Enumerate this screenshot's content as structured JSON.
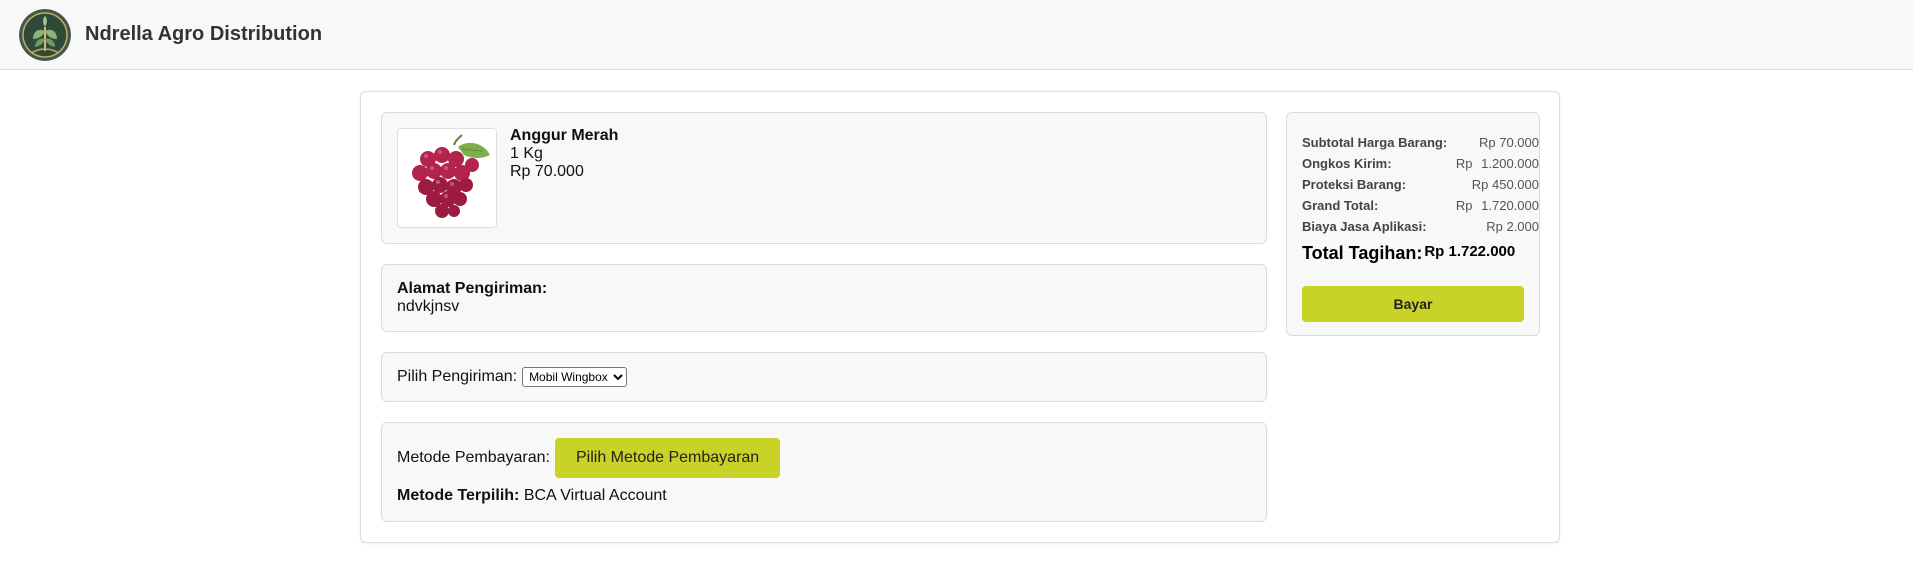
{
  "header": {
    "title": "Ndrella Agro Distribution",
    "logo_icon": "leaf-plant-logo-icon"
  },
  "product": {
    "image_icon": "red-grapes-image",
    "name": "Anggur Merah",
    "quantity": "1 Kg",
    "price": "Rp 70.000"
  },
  "address": {
    "label": "Alamat Pengiriman:",
    "value": "ndvkjnsv"
  },
  "shipping": {
    "label": "Pilih Pengiriman:",
    "selected": "Mobil Wingbox"
  },
  "payment": {
    "label": "Metode Pembayaran:",
    "button_label": "Pilih Metode Pembayaran",
    "selected_label": "Metode Terpilih:",
    "selected_value": "BCA Virtual Account"
  },
  "summary": {
    "rows": [
      {
        "label": "Subtotal Harga Barang:",
        "currency": "",
        "value": "Rp 70.000"
      },
      {
        "label": "Ongkos Kirim:",
        "currency": "Rp",
        "value": "1.200.000"
      },
      {
        "label": "Proteksi Barang:",
        "currency": "",
        "value": "Rp 450.000"
      },
      {
        "label": "Grand Total:",
        "currency": "Rp",
        "value": "1.720.000"
      },
      {
        "label": "Biaya Jasa Aplikasi:",
        "currency": "",
        "value": "Rp 2.000"
      }
    ],
    "total_label": "Total Tagihan:",
    "total_value": "Rp 1.722.000",
    "pay_button_label": "Bayar"
  },
  "colors": {
    "accent": "#c9d226",
    "panel_bg": "#f8f8f8",
    "header_bg": "#f8f8f8"
  }
}
